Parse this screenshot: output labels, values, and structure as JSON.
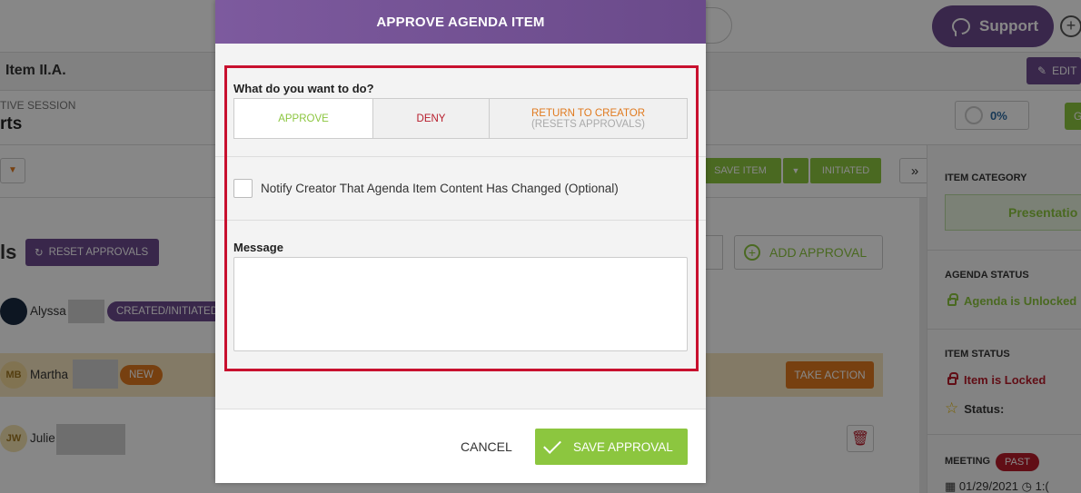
{
  "modal": {
    "title": "APPROVE AGENDA ITEM",
    "question": "What do you want to do?",
    "options": {
      "approve": "APPROVE",
      "deny": "DENY",
      "return_line1": "RETURN TO CREATOR",
      "return_line2": "(RESETS APPROVALS)"
    },
    "notify_label": "Notify Creator That Agenda Item Content Has Changed (Optional)",
    "message_label": "Message",
    "message_value": "",
    "cancel_label": "CANCEL",
    "save_label": "SAVE APPROVAL"
  },
  "background": {
    "support_label": "Support",
    "item_title": "Item II.A.",
    "edit_label": "EDIT",
    "session_label": "TIVE SESSION",
    "session_name": "rts",
    "progress_text": "0%",
    "green_stub": "G",
    "save_item_label": "SAVE ITEM",
    "initiated_label": "INITIATED",
    "collapse_icon": "»",
    "approvals_heading": "ls",
    "reset_approvals_label": "RESET APPROVALS",
    "add_approval_label": "ADD APPROVAL",
    "approvers": [
      {
        "name": "Alyssa",
        "initials": "",
        "badge": "CREATED/INITIATED"
      },
      {
        "name": "Martha",
        "initials": "MB",
        "badge": "NEW"
      },
      {
        "name": "Julie",
        "initials": "JW",
        "badge": ""
      }
    ],
    "take_action_label": "TAKE ACTION",
    "right_panel": {
      "item_category_label": "ITEM CATEGORY",
      "item_category_value": "Presentatio",
      "agenda_status_label": "AGENDA STATUS",
      "agenda_status_value": "Agenda is Unlocked",
      "item_status_label": "ITEM STATUS",
      "item_status_value": "Item is Locked",
      "status_label": "Status:",
      "meeting_label": "MEETING",
      "meeting_badge": "PAST",
      "meeting_date": "01/29/2021",
      "meeting_time": "1:("
    }
  },
  "colors": {
    "purple": "#6c4a8f",
    "green": "#8cc63f",
    "red": "#b71c2b",
    "orange": "#e07a1f",
    "highlight_frame": "#c8102e"
  }
}
